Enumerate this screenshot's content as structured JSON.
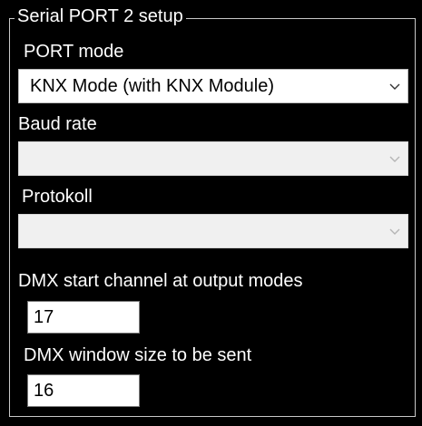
{
  "group": {
    "title": "Serial PORT 2 setup"
  },
  "port_mode": {
    "label": "PORT mode",
    "value": "KNX Mode (with KNX Module)"
  },
  "baud_rate": {
    "label": "Baud rate",
    "value": "",
    "enabled": false
  },
  "protokoll": {
    "label": "Protokoll",
    "value": "",
    "enabled": false
  },
  "dmx_start": {
    "label": "DMX start channel at output modes",
    "value": "17"
  },
  "dmx_window": {
    "label": "DMX window size to be sent",
    "value": "16"
  },
  "icons": {
    "dropdown": "chevron-down-icon"
  },
  "colors": {
    "background": "#000000",
    "text": "#ffffff",
    "field_bg": "#ffffff",
    "disabled_bg": "#f0f0f0"
  }
}
